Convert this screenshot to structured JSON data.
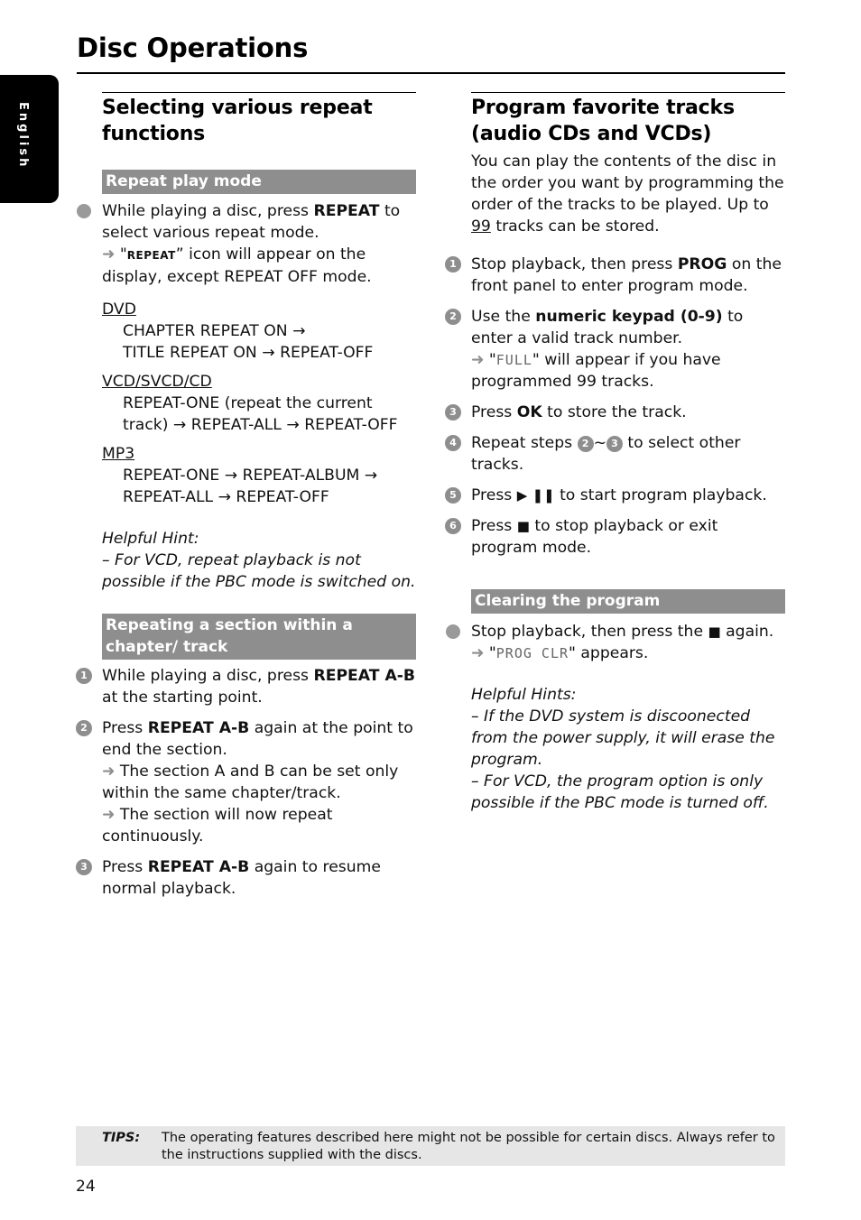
{
  "page": {
    "title": "Disc Operations",
    "language_tab": "English",
    "page_number": "24"
  },
  "left": {
    "heading": "Selecting various repeat functions",
    "repeat_mode": {
      "bar": "Repeat play mode",
      "bullet_pre": "While playing a disc, press ",
      "bullet_bold": "REPEAT",
      "bullet_post": " to select various repeat mode.",
      "result_pre": "\"",
      "result_icon": "REPEAT",
      "result_post": "” icon will appear on the display, except REPEAT OFF mode.",
      "groups": [
        {
          "label": "DVD",
          "lines": [
            "CHAPTER REPEAT ON →",
            "TITLE REPEAT ON → REPEAT-OFF"
          ]
        },
        {
          "label": "VCD/SVCD/CD",
          "lines": [
            "REPEAT-ONE (repeat the current track) → REPEAT-ALL → REPEAT-OFF"
          ]
        },
        {
          "label": "MP3",
          "lines": [
            "REPEAT-ONE → REPEAT-ALBUM → REPEAT-ALL → REPEAT-OFF"
          ]
        }
      ],
      "hint_title": "Helpful Hint:",
      "hint_text": "–  For VCD, repeat playback is not possible if the PBC mode is switched on."
    },
    "ab": {
      "bar": "Repeating a section within a chapter/ track",
      "steps": [
        {
          "num": "1",
          "pre": "While playing a disc, press ",
          "bold": "REPEAT A-B",
          "post": " at the starting point."
        },
        {
          "num": "2",
          "pre": "Press ",
          "bold": "REPEAT A-B",
          "post": " again at the point to end the section.",
          "results": [
            "The section A and B can be set only within the same chapter/track.",
            "The section will now repeat continuously."
          ]
        },
        {
          "num": "3",
          "pre": "Press ",
          "bold": "REPEAT A-B",
          "post": " again to resume normal playback."
        }
      ]
    }
  },
  "right": {
    "heading": "Program favorite tracks (audio CDs and VCDs)",
    "intro_pre": "You can play the contents of the disc in the order you want by programming the order of the tracks to be played. Up to ",
    "intro_num": "99",
    "intro_post": " tracks can be stored.",
    "steps": [
      {
        "num": "1",
        "pre": "Stop playback, then press ",
        "bold": "PROG",
        "post": " on the front panel to enter program mode."
      },
      {
        "num": "2",
        "pre": "Use the ",
        "bold": "numeric keypad (0-9)",
        "post": " to enter a valid track number.",
        "lcd": "FULL",
        "result_post": "\" will appear if you have programmed 99 tracks."
      },
      {
        "num": "3",
        "pre": "Press ",
        "bold": "OK",
        "post": " to store the track."
      },
      {
        "num": "4",
        "pre": "Repeat steps ",
        "ref_a": "2",
        "sep": "~",
        "ref_b": "3",
        "post": " to select other tracks."
      },
      {
        "num": "5",
        "pre": "Press ",
        "glyph": "▶ ❚❚",
        "post": " to start program playback."
      },
      {
        "num": "6",
        "pre": "Press ",
        "glyph": "■",
        "post": " to stop playback or exit program mode."
      }
    ],
    "clear": {
      "bar": "Clearing the program",
      "bullet_pre": "Stop playback, then press the ",
      "bullet_glyph": "■",
      "bullet_post": " again.",
      "lcd": "PROG CLR",
      "result_post": "\" appears.",
      "hint_title": "Helpful Hints:",
      "hints": [
        "–  If the DVD system is discoonected from the power supply, it will erase the program.",
        "–  For VCD, the program option is only possible if the PBC mode is turned off."
      ]
    }
  },
  "tips": {
    "label": "TIPS:",
    "text": "The operating features described here might not be possible for certain discs.  Always refer to the instructions supplied with the discs."
  },
  "icons": {
    "result_arrow": "➜",
    "bullet": "●"
  }
}
